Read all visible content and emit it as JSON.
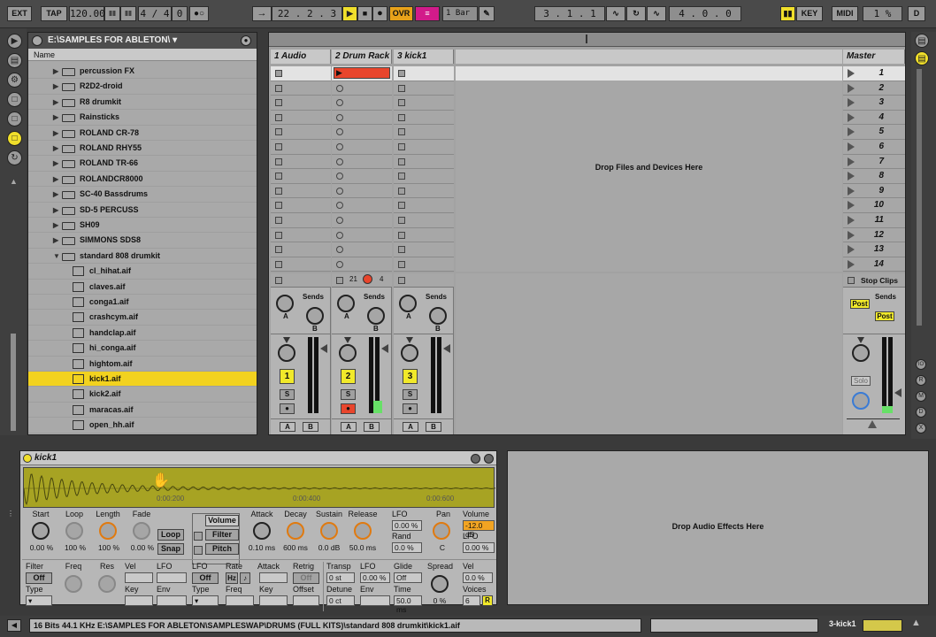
{
  "transport": {
    "ext": "EXT",
    "tap": "TAP",
    "tempo": "120.00",
    "signature": "4 / 4",
    "metro_off": "0",
    "position": "22 .   2 .   3",
    "ovr": "OVR",
    "quantize": "1 Bar",
    "loop_start": "3 .   1 .   1",
    "loop_length": "4 .   0 .   0",
    "key": "KEY",
    "midi": "MIDI",
    "cpu": "1 %",
    "d": "D"
  },
  "browser": {
    "path": "E:\\SAMPLES FOR ABLETON\\ ▾",
    "column": "Name",
    "items": [
      {
        "label": "percussion FX",
        "type": "folder"
      },
      {
        "label": "R2D2-droid",
        "type": "folder"
      },
      {
        "label": "R8 drumkit",
        "type": "folder"
      },
      {
        "label": "Rainsticks",
        "type": "folder"
      },
      {
        "label": "ROLAND CR-78",
        "type": "folder"
      },
      {
        "label": "ROLAND RHY55",
        "type": "folder"
      },
      {
        "label": "ROLAND TR-66",
        "type": "folder"
      },
      {
        "label": "ROLANDCR8000",
        "type": "folder"
      },
      {
        "label": "SC-40 Bassdrums",
        "type": "folder"
      },
      {
        "label": "SD-5 PERCUSS",
        "type": "folder"
      },
      {
        "label": "SH09",
        "type": "folder"
      },
      {
        "label": "SIMMONS SDS8",
        "type": "folder"
      },
      {
        "label": "standard 808 drumkit",
        "type": "open-folder"
      },
      {
        "label": "cl_hihat.aif",
        "type": "file"
      },
      {
        "label": "claves.aif",
        "type": "file"
      },
      {
        "label": "conga1.aif",
        "type": "file"
      },
      {
        "label": "crashcym.aif",
        "type": "file"
      },
      {
        "label": "handclap.aif",
        "type": "file"
      },
      {
        "label": "hi_conga.aif",
        "type": "file"
      },
      {
        "label": "hightom.aif",
        "type": "file"
      },
      {
        "label": "kick1.aif",
        "type": "file",
        "selected": true
      },
      {
        "label": "kick2.aif",
        "type": "file"
      },
      {
        "label": "maracas.aif",
        "type": "file"
      },
      {
        "label": "open_hh.aif",
        "type": "file"
      }
    ]
  },
  "session": {
    "tracks": [
      {
        "name": "1 Audio",
        "number": "1"
      },
      {
        "name": "2 Drum Rack",
        "number": "2",
        "info_a": "21",
        "info_b": "4"
      },
      {
        "name": "3 kick1",
        "number": "3"
      }
    ],
    "drop_text": "Drop Files and Devices Here",
    "master": "Master",
    "scenes": [
      "1",
      "2",
      "3",
      "4",
      "5",
      "6",
      "7",
      "8",
      "9",
      "10",
      "11",
      "12",
      "13",
      "14"
    ],
    "sends": "Sends",
    "knob_a": "A",
    "knob_b": "B",
    "solo_s": "S",
    "stop_clips": "Stop Clips",
    "post": "Post",
    "solo": "Solo",
    "ab_a": "A",
    "ab_b": "B"
  },
  "device": {
    "title": "kick1",
    "wave_marks": [
      "0:00:200",
      "0:00:400",
      "0:00:600"
    ],
    "row1_labels": [
      "Start",
      "Loop",
      "Length",
      "Fade"
    ],
    "row1_values": [
      "0.00 %",
      "100 %",
      "100 %",
      "0.00 %"
    ],
    "loop_btn": "Loop",
    "snap_btn": "Snap",
    "tabs": [
      "Volume",
      "Filter",
      "Pitch"
    ],
    "env_labels": [
      "Attack",
      "Decay",
      "Sustain",
      "Release"
    ],
    "env_values": [
      "0.10 ms",
      "600 ms",
      "0.0 dB",
      "50.0 ms"
    ],
    "lfo": "LFO",
    "lfo_val": "0.00 %",
    "rand": "Rand",
    "rand_val": "0.0 %",
    "pan": "Pan",
    "pan_val": "C",
    "volume": "Volume",
    "volume_val": "-12.0 dB",
    "vol_lfo": "LFO",
    "vol_lfo_val": "0.00 %",
    "filter": "Filter",
    "filter_off": "Off",
    "type": "Type",
    "freq": "Freq",
    "res": "Res",
    "vel": "Vel",
    "lfo2": "LFO",
    "key": "Key",
    "env": "Env",
    "lfo_sec": "LFO",
    "lfo_off": "Off",
    "lfo_type": "Type",
    "rate": "Rate",
    "rate_hz": "Hz",
    "rate_note": "♪",
    "lfo_freq": "Freq",
    "attack": "Attack",
    "lfo_key": "Key",
    "retrig": "Retrig",
    "retrig_off": "Off",
    "offset": "Offset",
    "transp": "Transp",
    "transp_val": "0 st",
    "detune": "Detune",
    "detune_val": "0 ct",
    "lfo3": "LFO",
    "lfo3_val": "0.00 %",
    "env2": "Env",
    "glide": "Glide",
    "glide_val": "Off",
    "time": "Time",
    "time_val": "50.0 ms",
    "spread": "Spread",
    "spread_val": "0 %",
    "vel2": "Vel",
    "vel2_val": "0.0 %",
    "voices": "Voices",
    "voices_val": "6",
    "r": "R"
  },
  "fx_drop": "Drop Audio Effects Here",
  "status": {
    "text": "16 Bits 44.1 KHz E:\\SAMPLES FOR ABLETON\\SAMPLESWAP\\DRUMS (FULL KITS)\\standard 808 drumkit\\kick1.aif",
    "track": "3-kick1"
  },
  "colors": {
    "accent": "#f2d21f",
    "clip_red": "#e8452c",
    "ovr": "#e8a21a",
    "follow": "#d21b8a",
    "device_wave": "#a7a323"
  }
}
